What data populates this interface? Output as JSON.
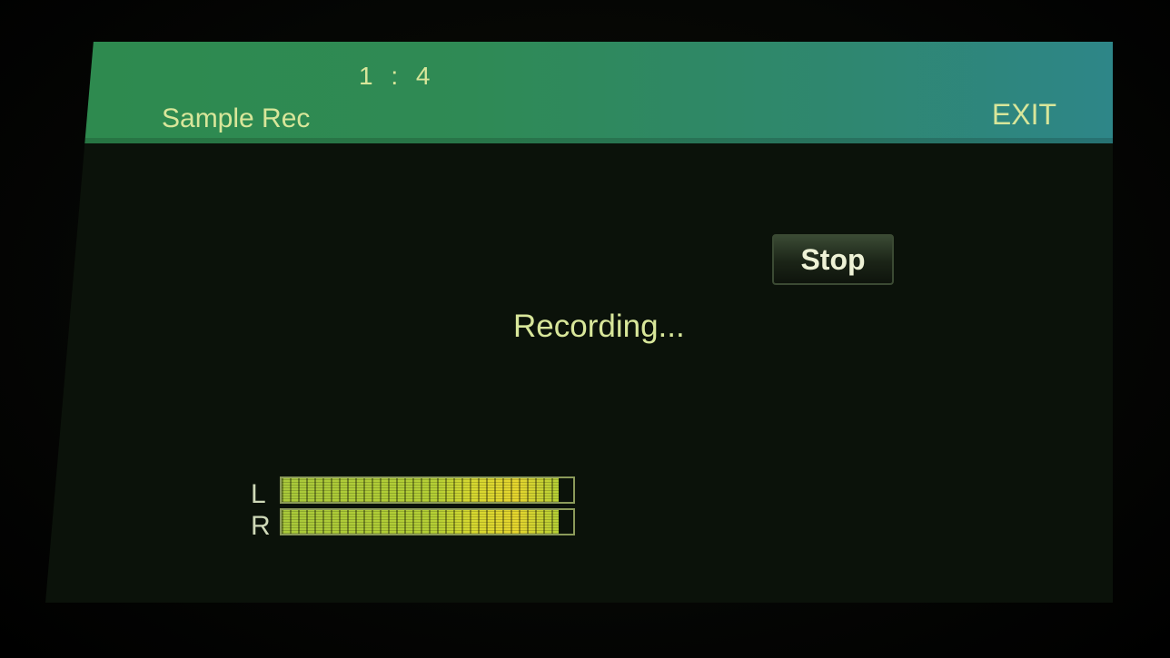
{
  "header": {
    "counter": "1 : 4",
    "title": "Sample Rec",
    "exit_label": "EXIT"
  },
  "main": {
    "stop_label": "Stop",
    "status_text": "Recording..."
  },
  "meters": [
    {
      "label": "L",
      "level": 0.95
    },
    {
      "label": "R",
      "level": 0.95
    }
  ],
  "colors": {
    "header_bg": "#2f8a55",
    "text": "#d8e69a",
    "meter_fill": "#b4cf35",
    "screen_bg": "#0b120a"
  }
}
